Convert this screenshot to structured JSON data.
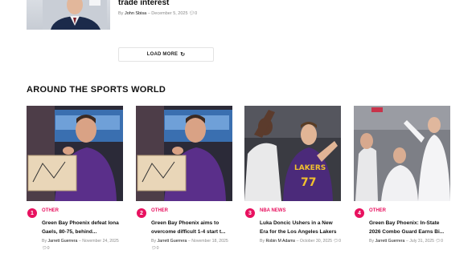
{
  "top_article": {
    "title": "trade interest",
    "by": "By",
    "author": "John Sbisa",
    "sep": "–",
    "date": "December 5, 2025",
    "comments": "0"
  },
  "load_more": {
    "label": "LOAD MORE",
    "icon": "refresh-icon"
  },
  "section": {
    "title": "AROUND THE SPORTS WORLD"
  },
  "cards": [
    {
      "rank": "1",
      "category": "OTHER",
      "title": "Green Bay Phoenix defeat Iona Gaels, 80-75, behind...",
      "by": "By",
      "author": "Jarrett Guerrera",
      "date": "–  November 24, 2025",
      "comments": "0"
    },
    {
      "rank": "2",
      "category": "OTHER",
      "title": "Green Bay Phoenix aims to overcome difficult 1-4 start t...",
      "by": "By",
      "author": "Jarrett Guerrera",
      "date": "–  November 18, 2025",
      "comments": "0"
    },
    {
      "rank": "3",
      "category": "NBA NEWS",
      "title": "Luka Doncic Ushers in a New Era for the Los Angeles Lakers",
      "by": "By",
      "author": "Robin M Adams",
      "date": "–  October 30, 2025",
      "comments": "0"
    },
    {
      "rank": "4",
      "category": "OTHER",
      "title": "Green Bay Phoenix: In-State 2026 Combo Guard Earns Bi...",
      "by": "By",
      "author": "Jarrett Guerrera",
      "date": "–  July 31, 2025",
      "comments": "0"
    }
  ],
  "colors": {
    "accent": "#e8115f",
    "text": "#111111",
    "muted": "#8a8a8a"
  }
}
